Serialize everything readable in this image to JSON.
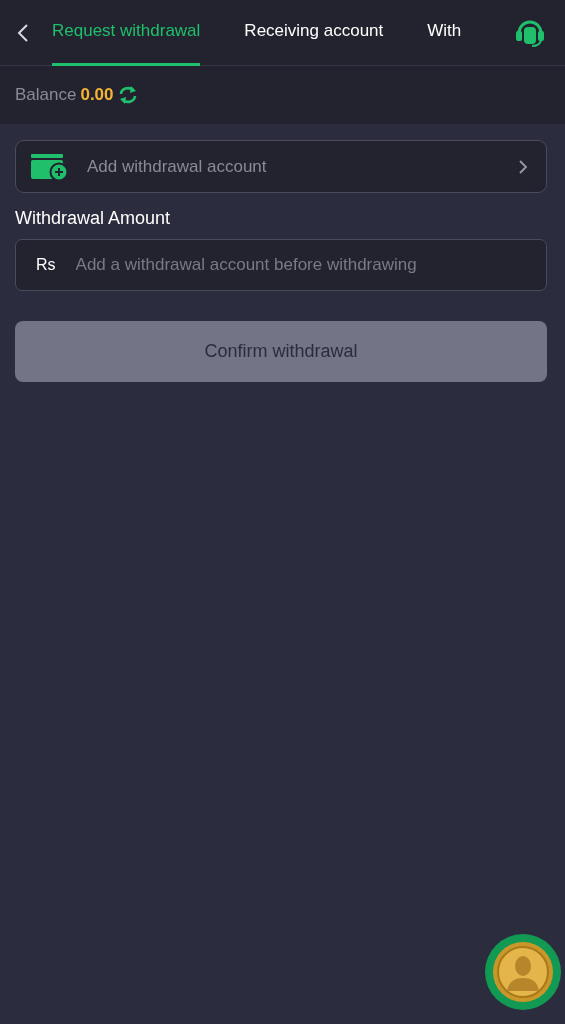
{
  "tabs": [
    {
      "label": "Request withdrawal",
      "selected": true
    },
    {
      "label": "Receiving account",
      "selected": false
    },
    {
      "label": "With",
      "selected": false
    }
  ],
  "balance": {
    "label": "Balance",
    "value": "0.00"
  },
  "account_row": {
    "label": "Add withdrawal account"
  },
  "amount": {
    "label": "Withdrawal Amount",
    "currency": "Rs",
    "placeholder": "Add a withdrawal account before withdrawing"
  },
  "confirm_button": {
    "label": "Confirm withdrawal",
    "disabled": true
  }
}
